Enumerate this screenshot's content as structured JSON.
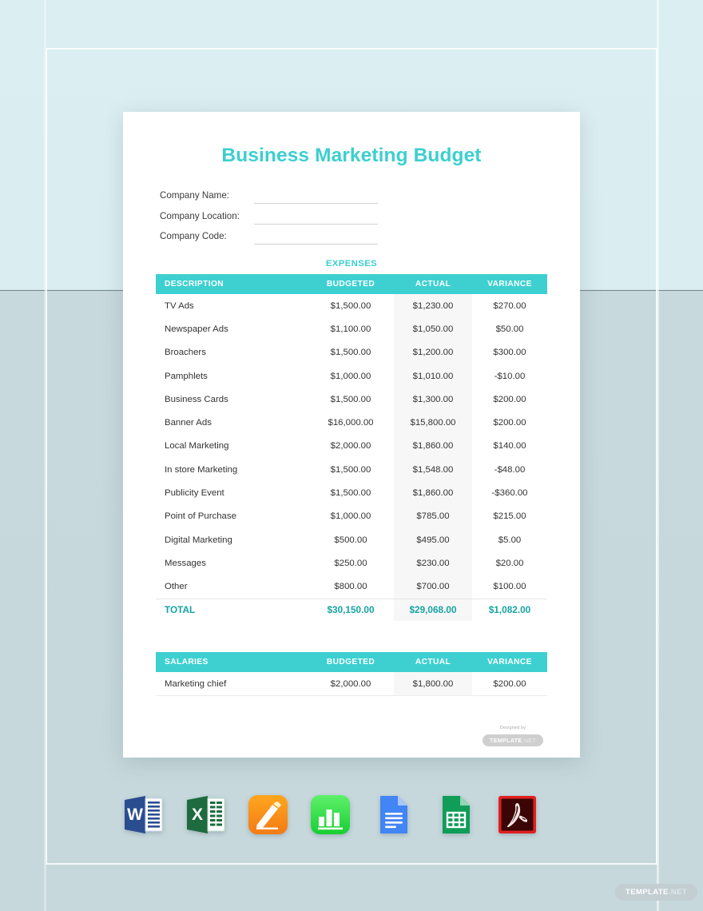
{
  "document": {
    "title": "Business Marketing  Budget",
    "title_color": "#3ccfcf",
    "header_color": "#3ed0d0",
    "total_color": "#16a3a3",
    "fields": [
      {
        "label": "Company Name:",
        "value": ""
      },
      {
        "label": "Company Location:",
        "value": ""
      },
      {
        "label": "Company Code:",
        "value": ""
      }
    ],
    "expenses": {
      "caption": "EXPENSES",
      "columns": [
        "DESCRIPTION",
        "BUDGETED",
        "ACTUAL",
        "VARIANCE"
      ],
      "rows": [
        {
          "description": "TV Ads",
          "budgeted": "$1,500.00",
          "actual": "$1,230.00",
          "variance": "$270.00"
        },
        {
          "description": "Newspaper Ads",
          "budgeted": "$1,100.00",
          "actual": "$1,050.00",
          "variance": "$50.00"
        },
        {
          "description": "Broachers",
          "budgeted": "$1,500.00",
          "actual": "$1,200.00",
          "variance": "$300.00"
        },
        {
          "description": "Pamphlets",
          "budgeted": "$1,000.00",
          "actual": "$1,010.00",
          "variance": "-$10.00"
        },
        {
          "description": "Business Cards",
          "budgeted": "$1,500.00",
          "actual": "$1,300.00",
          "variance": "$200.00"
        },
        {
          "description": "Banner Ads",
          "budgeted": "$16,000.00",
          "actual": "$15,800.00",
          "variance": "$200.00"
        },
        {
          "description": "Local Marketing",
          "budgeted": "$2,000.00",
          "actual": "$1,860.00",
          "variance": "$140.00"
        },
        {
          "description": "In store Marketing",
          "budgeted": "$1,500.00",
          "actual": "$1,548.00",
          "variance": "-$48.00"
        },
        {
          "description": "Publicity Event",
          "budgeted": "$1,500.00",
          "actual": "$1,860.00",
          "variance": "-$360.00"
        },
        {
          "description": "Point of Purchase",
          "budgeted": "$1,000.00",
          "actual": "$785.00",
          "variance": "$215.00"
        },
        {
          "description": "Digital Marketing",
          "budgeted": "$500.00",
          "actual": "$495.00",
          "variance": "$5.00"
        },
        {
          "description": "Messages",
          "budgeted": "$250.00",
          "actual": "$230.00",
          "variance": "$20.00"
        },
        {
          "description": "Other",
          "budgeted": "$800.00",
          "actual": "$700.00",
          "variance": "$100.00"
        }
      ],
      "total": {
        "description": "TOTAL",
        "budgeted": "$30,150.00",
        "actual": "$29,068.00",
        "variance": "$1,082.00"
      }
    },
    "salaries": {
      "columns": [
        "SALARIES",
        "BUDGETED",
        "ACTUAL",
        "VARIANCE"
      ],
      "rows": [
        {
          "description": "Marketing chief",
          "budgeted": "$2,000.00",
          "actual": "$1,800.00",
          "variance": "$200.00"
        }
      ]
    },
    "designed_by": {
      "label": "Designed by",
      "brand": "TEMPLATE",
      "brand_suffix": ".NET"
    }
  },
  "app_icons": [
    {
      "name": "microsoft-word-icon",
      "label": "Word"
    },
    {
      "name": "microsoft-excel-icon",
      "label": "Excel"
    },
    {
      "name": "apple-pages-icon",
      "label": "Pages"
    },
    {
      "name": "apple-numbers-icon",
      "label": "Numbers"
    },
    {
      "name": "google-docs-icon",
      "label": "Google Docs"
    },
    {
      "name": "google-sheets-icon",
      "label": "Google Sheets"
    },
    {
      "name": "adobe-pdf-icon",
      "label": "PDF"
    }
  ],
  "watermark": {
    "brand": "TEMPLATE",
    "brand_suffix": ".NET"
  }
}
